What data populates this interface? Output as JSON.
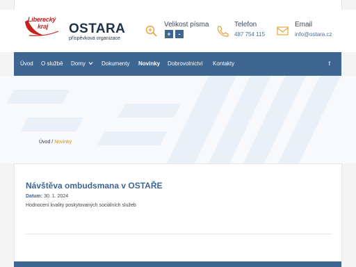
{
  "header": {
    "region_logo_line1": "Liberecký",
    "region_logo_line2": "kraj",
    "brand_name": "OSTARA",
    "brand_subtitle": "příspěvková organizace",
    "font_size": {
      "label": "Velikost písma",
      "increase": "+",
      "decrease": "-"
    },
    "phone": {
      "label": "Telefon",
      "value": "487 754 115"
    },
    "email": {
      "label": "Email",
      "value": "info@ostara.cz"
    }
  },
  "nav": {
    "items": [
      {
        "label": "Úvod"
      },
      {
        "label": "O službě"
      },
      {
        "label": "Domy"
      },
      {
        "label": "Dokumenty"
      },
      {
        "label": "Novinky"
      },
      {
        "label": "Dobrovolnictví"
      },
      {
        "label": "Kontakty"
      }
    ],
    "active": "Novinky",
    "social": "f"
  },
  "breadcrumb": {
    "home": "Úvod",
    "separator": "/",
    "current": "Novinky"
  },
  "article": {
    "title": "Návštěva ombudsmana v OSTAŘE",
    "date_label": "Datum:",
    "date_value": "30. 1. 2024",
    "perex": "Hodnocení kvality poskytovaných sociálních služeb"
  },
  "colors": {
    "primary": "#3f6591",
    "accent": "#d38b12",
    "brand_red": "#c8201f",
    "icon_orange": "#e8a33a"
  }
}
